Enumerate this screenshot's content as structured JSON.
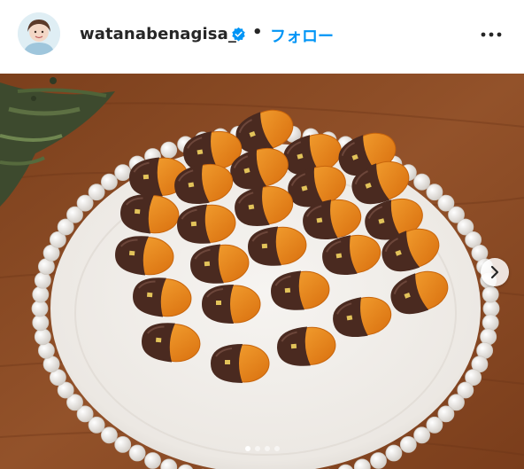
{
  "post": {
    "username": "watanabenagisa_",
    "separator": "•",
    "follow_label": "フォロー",
    "verified_icon": "verified-badge-icon",
    "more_icon": "more-horizontal-icon",
    "next_icon": "chevron-right-icon",
    "carousel": {
      "slide_count": 4,
      "active_index": 0
    }
  },
  "colors": {
    "link": "#0095f6",
    "text": "#262626",
    "table_wood": "#8a4a22",
    "plate": "#f1eeea",
    "chocolate": "#4a2a20",
    "orange": "#e8881c"
  }
}
